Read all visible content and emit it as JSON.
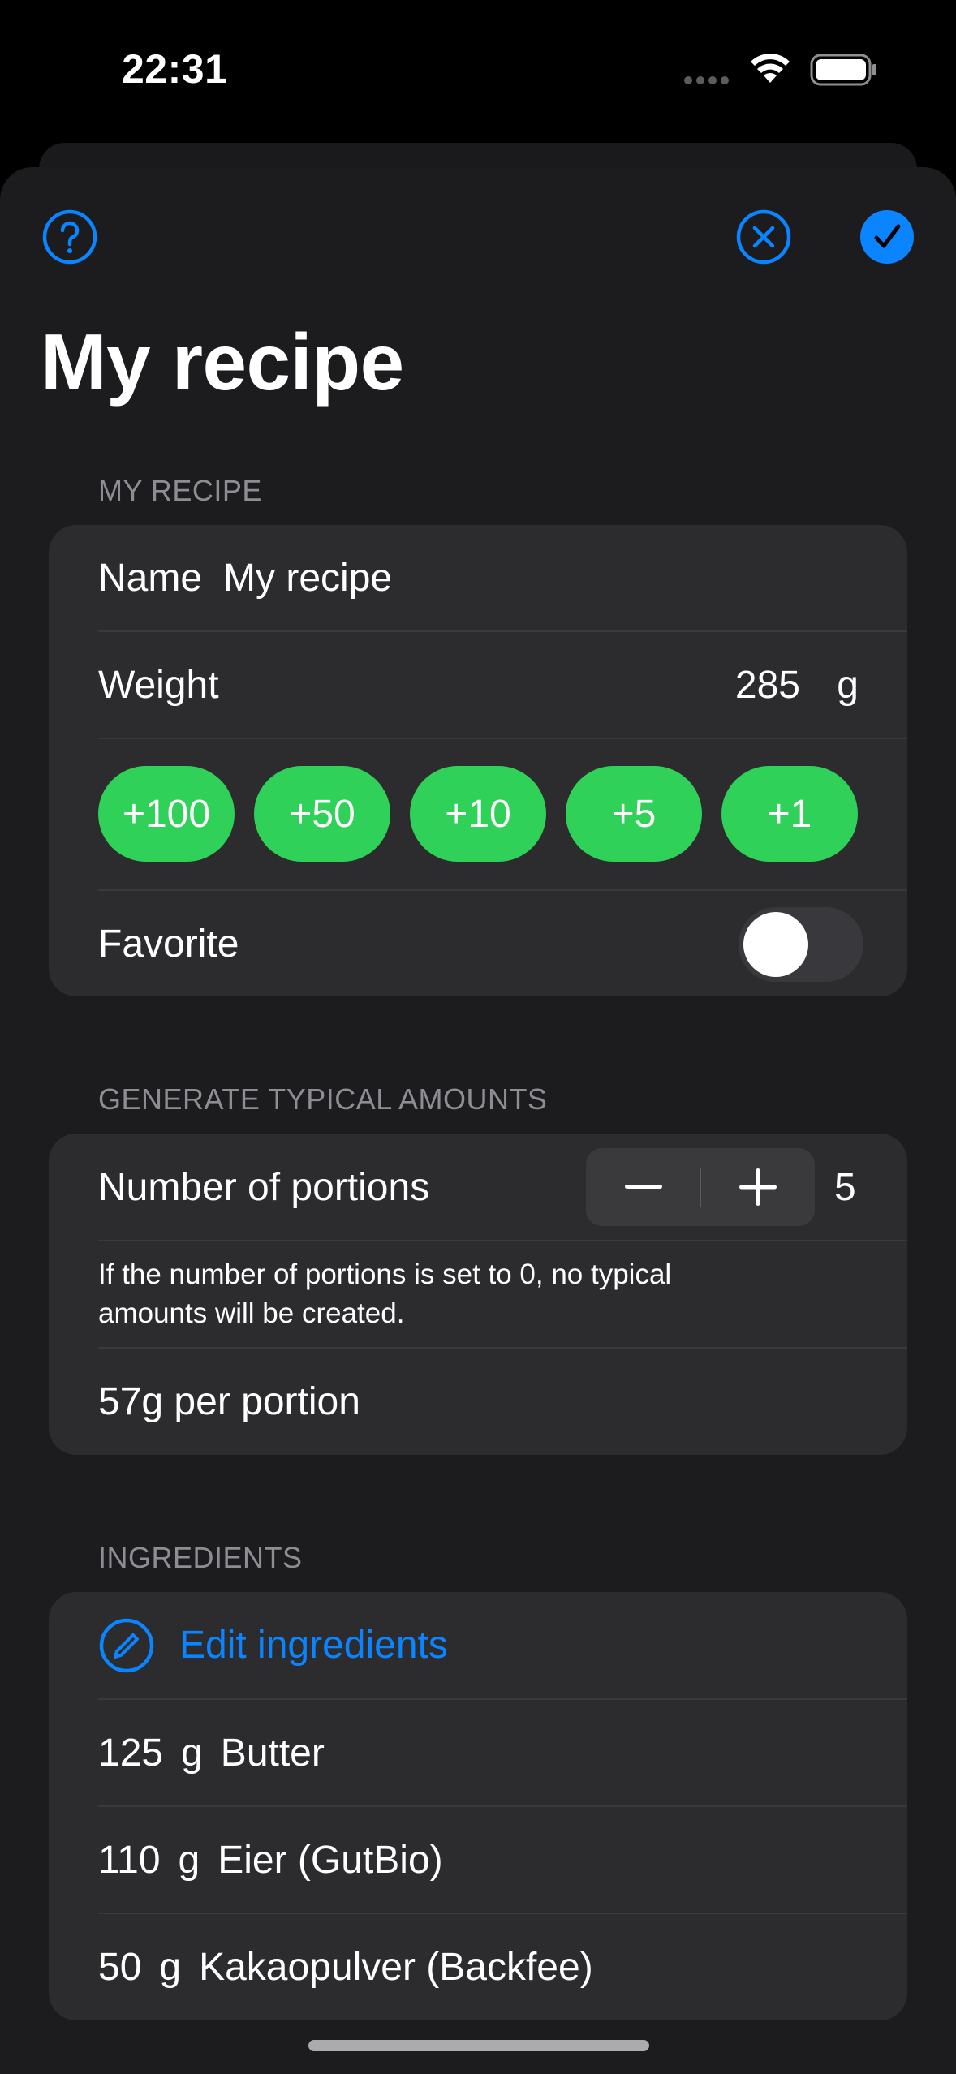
{
  "status_bar": {
    "time": "22:31"
  },
  "page": {
    "title": "My recipe"
  },
  "icons": {
    "help": "help-circle-icon",
    "cancel": "x-circle-icon",
    "confirm": "checkmark-circle-fill-icon",
    "edit": "pencil-circle-icon",
    "minus": "minus-icon",
    "plus": "plus-icon"
  },
  "colors": {
    "accent": "#0a84ff",
    "green": "#30d158",
    "group_bg": "#2c2c2e",
    "sheet_bg": "#1c1c1e",
    "secondary_text": "#8d8d93"
  },
  "recipe_section": {
    "header": "MY RECIPE",
    "name_label": "Name",
    "name_value": "My recipe",
    "weight_label": "Weight",
    "weight_value": "285",
    "weight_unit": "g",
    "increments": [
      "+100",
      "+50",
      "+10",
      "+5",
      "+1"
    ],
    "favorite_label": "Favorite",
    "favorite_on": false
  },
  "amounts_section": {
    "header": "GENERATE TYPICAL AMOUNTS",
    "portions_label": "Number of portions",
    "portions_value": "5",
    "info_line1": "If the number of portions is set to 0, no typical",
    "info_line2": "amounts will be created.",
    "per_portion": "57g per portion"
  },
  "ingredients_section": {
    "header": "INGREDIENTS",
    "edit_label": "Edit ingredients",
    "items": [
      {
        "amount": "125",
        "unit": "g",
        "name": "Butter"
      },
      {
        "amount": "110",
        "unit": "g",
        "name": "Eier (GutBio)"
      },
      {
        "amount": "50",
        "unit": "g",
        "name": "Kakaopulver (Backfee)"
      }
    ]
  }
}
